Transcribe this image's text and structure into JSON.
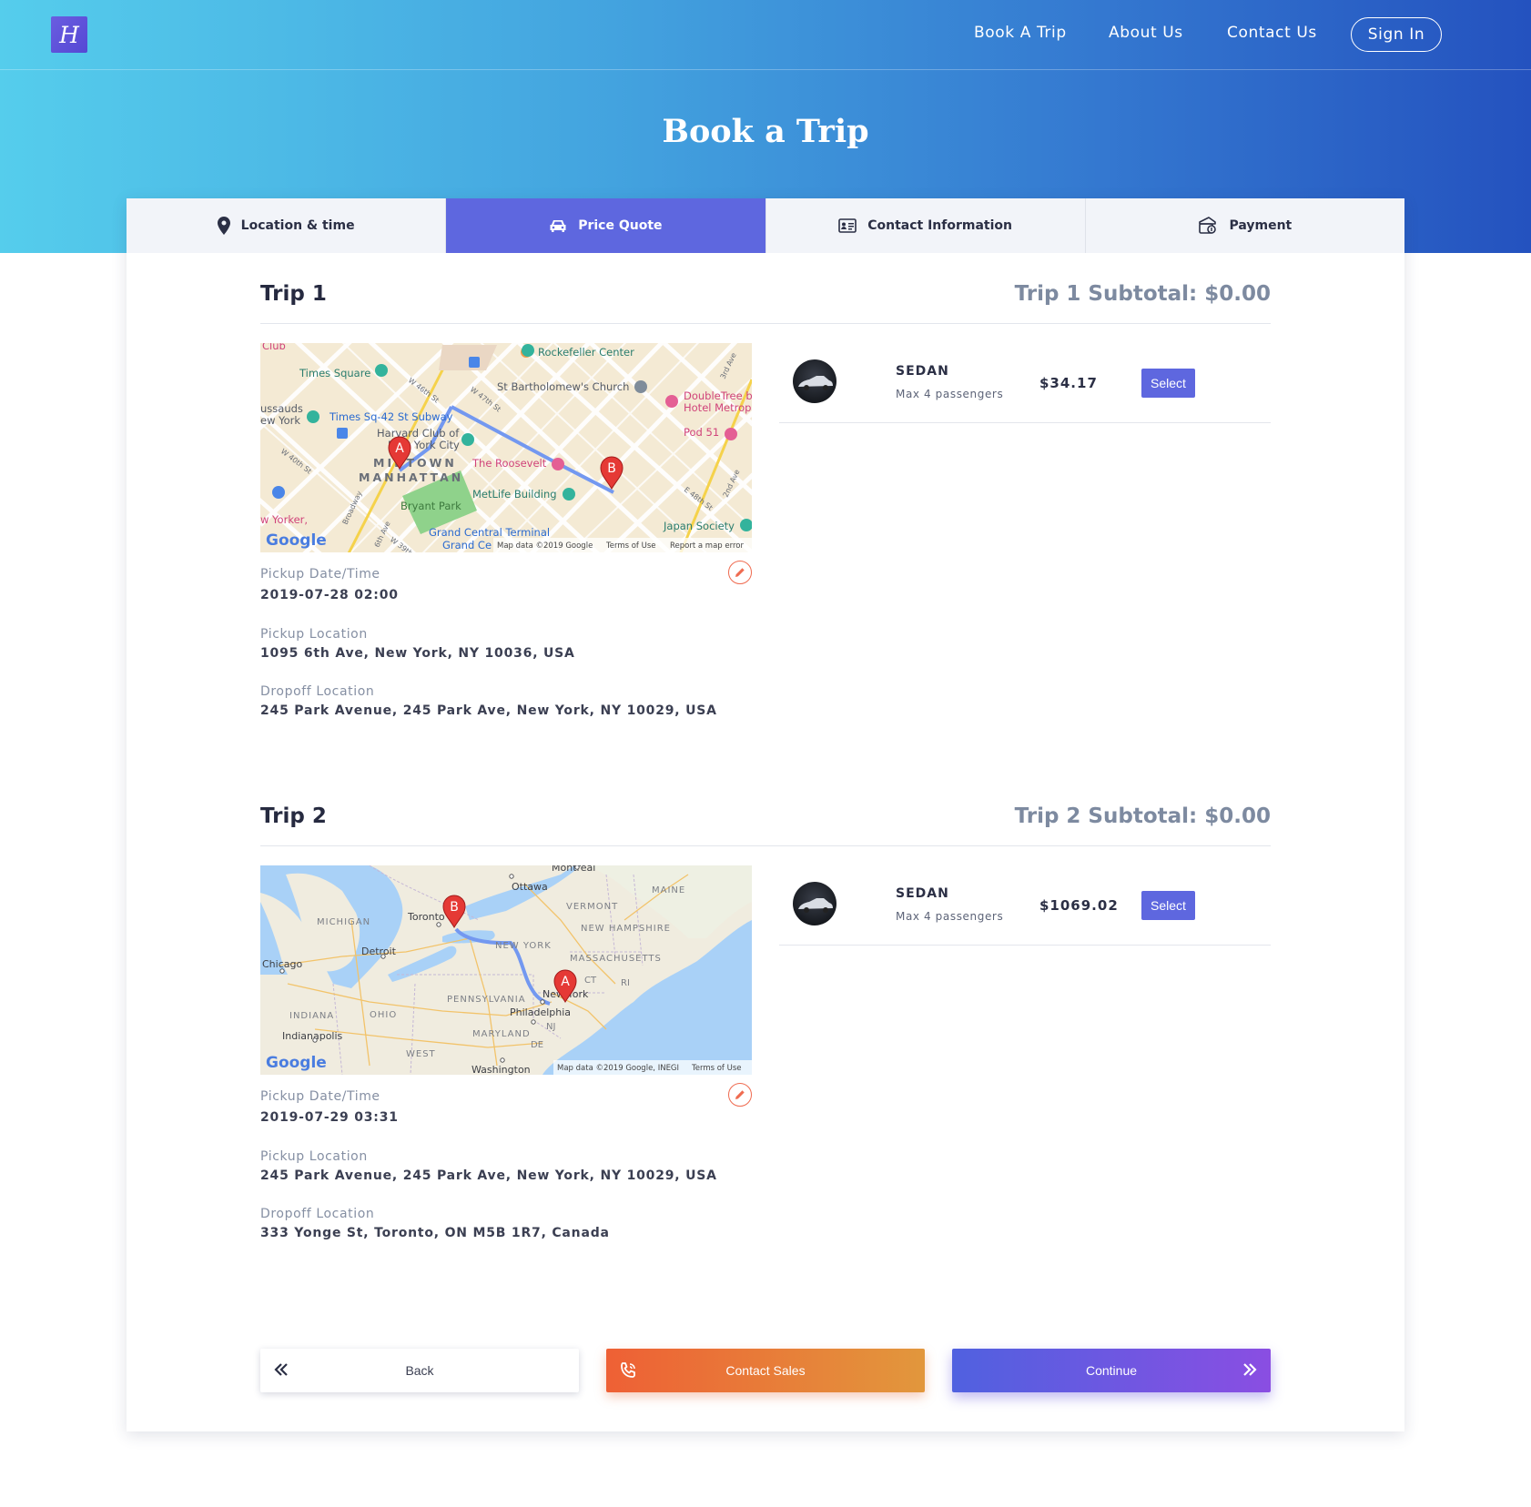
{
  "brand": {
    "logo_glyph": "H"
  },
  "nav": {
    "items": [
      "Book A Trip",
      "About Us",
      "Contact Us"
    ],
    "sign_in": "Sign In"
  },
  "page_title": "Book a Trip",
  "steps": [
    {
      "label": "Location & time",
      "icon": "map-pin-icon",
      "active": false
    },
    {
      "label": "Price Quote",
      "icon": "car-icon",
      "active": true
    },
    {
      "label": "Contact Information",
      "icon": "contact-card-icon",
      "active": false
    },
    {
      "label": "Payment",
      "icon": "payment-icon",
      "active": false
    }
  ],
  "trips": [
    {
      "title": "Trip 1",
      "subtotal": "Trip 1 Subtotal: $0.00",
      "map": {
        "attribution": "Map data ©2019 Google",
        "terms": "Terms of Use",
        "report": "Report a map error",
        "labels": [
          "Club",
          "Rockefeller Center",
          "Times Square",
          "St Bartholomew's Church",
          "DoubleTree b",
          "Hotel Metrop",
          "ussauds",
          "ew York",
          "Times Sq-42 St Subway",
          "Harvard Club of",
          "New York City",
          "MIDTOWN",
          "MANHATTAN",
          "The Roosevelt",
          "Pod 51",
          "MetLife Building",
          "Bryant Park",
          "Grand Central Terminal",
          "Grand Ce",
          "Japan Society",
          "w Yorker,",
          "3rd Ave",
          "2nd Ave",
          "E 48th St",
          "W 46th St",
          "W 47th St",
          "W 40th St",
          "W 39th St",
          "6th Ave",
          "Broadway",
          "Google",
          "A",
          "B"
        ]
      },
      "pickup_datetime_label": "Pickup Date/Time",
      "pickup_datetime": "2019-07-28 02:00",
      "pickup_location_label": "Pickup Location",
      "pickup_location": "1095 6th Ave, New York, NY 10036, USA",
      "dropoff_location_label": "Dropoff Location",
      "dropoff_location": "245 Park Avenue, 245 Park Ave, New York, NY 10029, USA",
      "vehicle": {
        "name": "SEDAN",
        "capacity": "Max 4 passengers",
        "price": "$34.17",
        "select_label": "Select"
      }
    },
    {
      "title": "Trip 2",
      "subtotal": "Trip 2 Subtotal: $0.00",
      "map": {
        "attribution": "Map data ©2019 Google, INEGI",
        "terms": "Terms of Use",
        "labels": [
          "Montreal",
          "Ottawa",
          "MAINE",
          "VERMONT",
          "NEW HAMPSHIRE",
          "MASSACHUSETTS",
          "CT",
          "RI",
          "MICHIGAN",
          "Toronto",
          "NEW YORK",
          "Detroit",
          "Chicago",
          "New York",
          "PENNSYLVANIA",
          "Philadelphia",
          "NJ",
          "DE",
          "MARYLAND",
          "INDIANA",
          "OHIO",
          "Indianapolis",
          "WEST",
          "Washington",
          "Google",
          "A",
          "B"
        ]
      },
      "pickup_datetime_label": "Pickup Date/Time",
      "pickup_datetime": "2019-07-29 03:31",
      "pickup_location_label": "Pickup Location",
      "pickup_location": "245 Park Avenue, 245 Park Ave, New York, NY 10029, USA",
      "dropoff_location_label": "Dropoff Location",
      "dropoff_location": "333 Yonge St, Toronto, ON M5B 1R7, Canada",
      "vehicle": {
        "name": "SEDAN",
        "capacity": "Max 4 passengers",
        "price": "$1069.02",
        "select_label": "Select"
      }
    }
  ],
  "actions": {
    "back": "Back",
    "contact_sales": "Contact Sales",
    "continue": "Continue"
  },
  "colors": {
    "accent": "#5e67df",
    "hero_start": "#55cdec",
    "hero_end": "#2452bf",
    "sales_start": "#ee6035",
    "sales_end": "#e2973c",
    "continue_start": "#5061e0",
    "continue_end": "#8a4ee2",
    "edit_icon": "#ef6b50"
  }
}
